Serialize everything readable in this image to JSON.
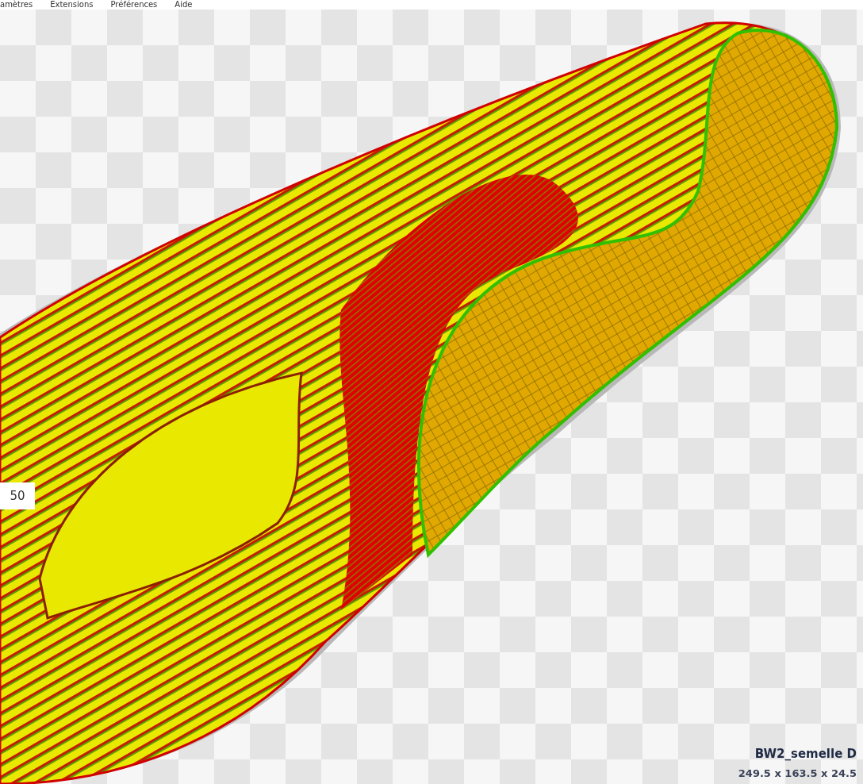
{
  "menu_bar": {
    "items": [
      "amètres",
      "Extensions",
      "Préférences",
      "Aide"
    ]
  },
  "layer_slider": {
    "value": "50"
  },
  "object_info": {
    "name": "BW2_semelle D",
    "dimensions": "249.5 x 163.5 x 24.5"
  }
}
